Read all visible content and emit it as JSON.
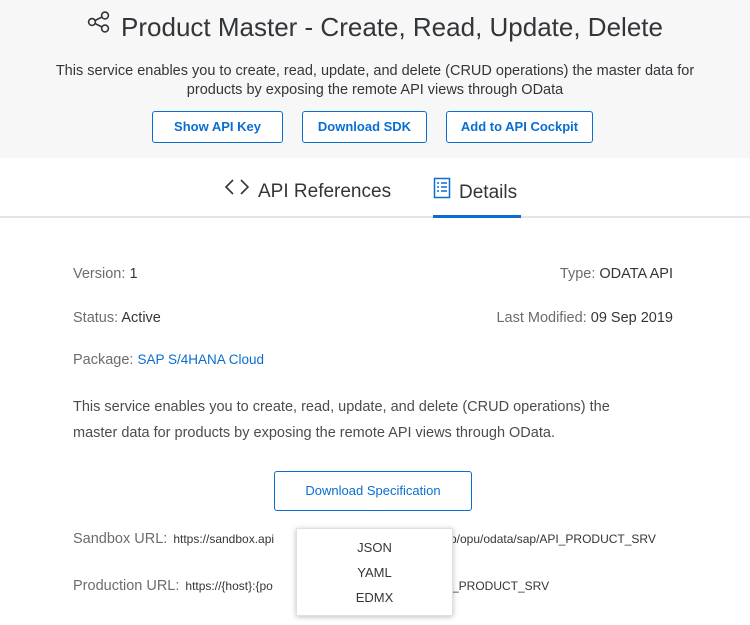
{
  "header": {
    "title": "Product Master - Create, Read, Update, Delete",
    "description_line1": "This service enables you to create, read, update, and delete (CRUD operations) the master data for",
    "description_line2": "products by exposing the remote API views through OData",
    "buttons": {
      "show_api_key": "Show API Key",
      "download_sdk": "Download SDK",
      "add_to_cockpit": "Add to API Cockpit"
    },
    "icon": "share-icon"
  },
  "tabs": [
    {
      "label": "API References",
      "icon": "code-icon",
      "active": false
    },
    {
      "label": "Details",
      "icon": "list-document-icon",
      "active": true
    }
  ],
  "details": {
    "version_label": "Version:",
    "version_value": "1",
    "type_label": "Type:",
    "type_value": "ODATA API",
    "status_label": "Status:",
    "status_value": "Active",
    "modified_label": "Last Modified:",
    "modified_value": "09 Sep 2019",
    "package_label": "Package:",
    "package_value": "SAP S/4HANA Cloud",
    "description_line1": "This service enables you to create, read, update, and delete (CRUD operations) the",
    "description_line2": "master data for products by exposing the remote API views through OData.",
    "download_spec": "Download Specification",
    "sandbox_label": "Sandbox URL:",
    "sandbox_url_visible_start": "https://sandbox.api",
    "sandbox_url_visible_end": "p/opu/odata/sap/API_PRODUCT_SRV",
    "production_label": "Production URL:",
    "production_url_visible_start": "https://{host}:{po",
    "production_url_visible_end": "_PRODUCT_SRV"
  },
  "format_menu": {
    "options": [
      "JSON",
      "YAML",
      "EDMX"
    ]
  },
  "colors": {
    "accent": "#0a6ed1",
    "header_bg": "#f7f7f7",
    "text": "#32363a"
  }
}
